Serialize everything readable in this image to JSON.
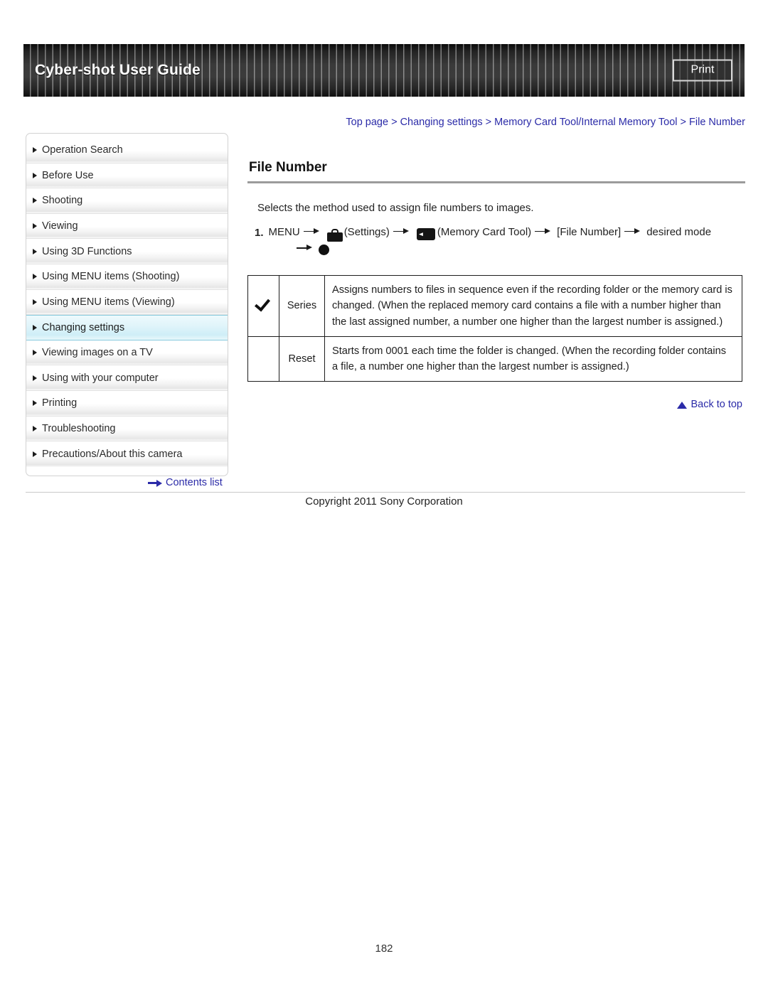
{
  "header": {
    "title": "Cyber-shot User Guide",
    "print_label": "Print"
  },
  "breadcrumb": {
    "text": "Top page > Changing settings > Memory Card Tool/Internal Memory Tool > File Number"
  },
  "sidebar": {
    "items": [
      {
        "label": "Operation Search",
        "selected": false
      },
      {
        "label": "Before Use",
        "selected": false
      },
      {
        "label": "Shooting",
        "selected": false
      },
      {
        "label": "Viewing",
        "selected": false
      },
      {
        "label": "Using 3D Functions",
        "selected": false
      },
      {
        "label": "Using MENU items (Shooting)",
        "selected": false
      },
      {
        "label": "Using MENU items (Viewing)",
        "selected": false
      },
      {
        "label": "Changing settings",
        "selected": true
      },
      {
        "label": "Viewing images on a TV",
        "selected": false
      },
      {
        "label": "Using with your computer",
        "selected": false
      },
      {
        "label": "Printing",
        "selected": false
      },
      {
        "label": "Troubleshooting",
        "selected": false
      },
      {
        "label": "Precautions/About this camera",
        "selected": false
      }
    ],
    "contents_link": "Contents list"
  },
  "main": {
    "title": "File Number",
    "intro": "Selects the method used to assign file numbers to images.",
    "step": {
      "number": "1.",
      "part_menu": "MENU",
      "part_settings": "(Settings)",
      "part_memory_card_tool": "(Memory Card Tool)",
      "part_file_number": "[File Number]",
      "part_desired_mode": "desired mode"
    },
    "table": {
      "rows": [
        {
          "checked": true,
          "label": "Series",
          "description": "Assigns numbers to files in sequence even if the recording folder or the memory card is changed. (When the replaced memory card contains a file with a number higher than the last assigned number, a number one higher than the largest number is assigned.)"
        },
        {
          "checked": false,
          "label": "Reset",
          "description": "Starts from 0001 each time the folder is changed. (When the recording folder contains a file, a number one higher than the largest number is assigned.)"
        }
      ]
    },
    "back_to_top": "Back to top"
  },
  "footer": {
    "copyright": "Copyright 2011 Sony Corporation",
    "page_number": "182"
  }
}
